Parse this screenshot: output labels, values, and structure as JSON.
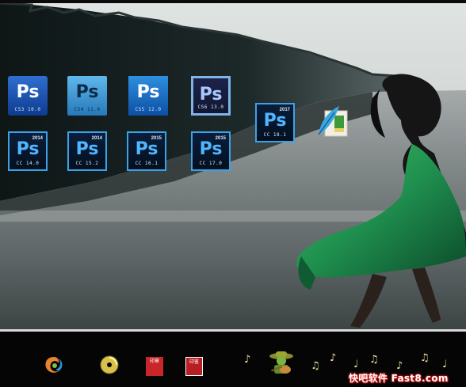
{
  "desktop": {
    "icons": [
      {
        "name": "photoshop-cs3-icon",
        "label": "Ps",
        "year": "",
        "version": "CS3 10.0",
        "style": "cs3"
      },
      {
        "name": "photoshop-cs4-icon",
        "label": "Ps",
        "year": "",
        "version": "CS4 11.0",
        "style": "cs4"
      },
      {
        "name": "photoshop-cs5-icon",
        "label": "Ps",
        "year": "",
        "version": "CS5 12.0",
        "style": "cs5"
      },
      {
        "name": "photoshop-cs6-icon",
        "label": "Ps",
        "year": "",
        "version": "CS6 13.0",
        "style": "cs6"
      },
      {
        "name": "photoshop-cc-2017-icon",
        "label": "Ps",
        "year": "2017",
        "version": "CC 18.1",
        "style": "cc"
      },
      {
        "name": "photoshop-cc-2014-icon",
        "label": "Ps",
        "year": "2014",
        "version": "CC 14.0",
        "style": "cc"
      },
      {
        "name": "photoshop-cc-2014-2-icon",
        "label": "Ps",
        "year": "2014",
        "version": "CC 15.2",
        "style": "cc"
      },
      {
        "name": "photoshop-cc-2015-icon",
        "label": "Ps",
        "year": "2015",
        "version": "CC 16.1",
        "style": "cc"
      },
      {
        "name": "photoshop-cc-2015-2-icon",
        "label": "Ps",
        "year": "2015",
        "version": "CC 17.0",
        "style": "cc"
      }
    ],
    "feather_icon": "feather-image-editor-icon"
  },
  "taskbar": {
    "icons": [
      "swirl-logo-icon",
      "cd-disc-icon",
      "red-seal-icon",
      "red-seal-icon-2",
      "cowboy-guitar-icon"
    ],
    "seal_text_1": "印章",
    "seal_text_2": "印鉴",
    "notes": [
      "♪",
      "♫",
      "♪",
      "♩",
      "♫",
      "♪",
      "♫",
      "♩"
    ],
    "watermark": "快吧软件 Fast8.com"
  },
  "colors": {
    "ps_blue": "#3aa3e8",
    "taskbar_bg": "#050505",
    "dress_green": "#1f8f4e"
  }
}
